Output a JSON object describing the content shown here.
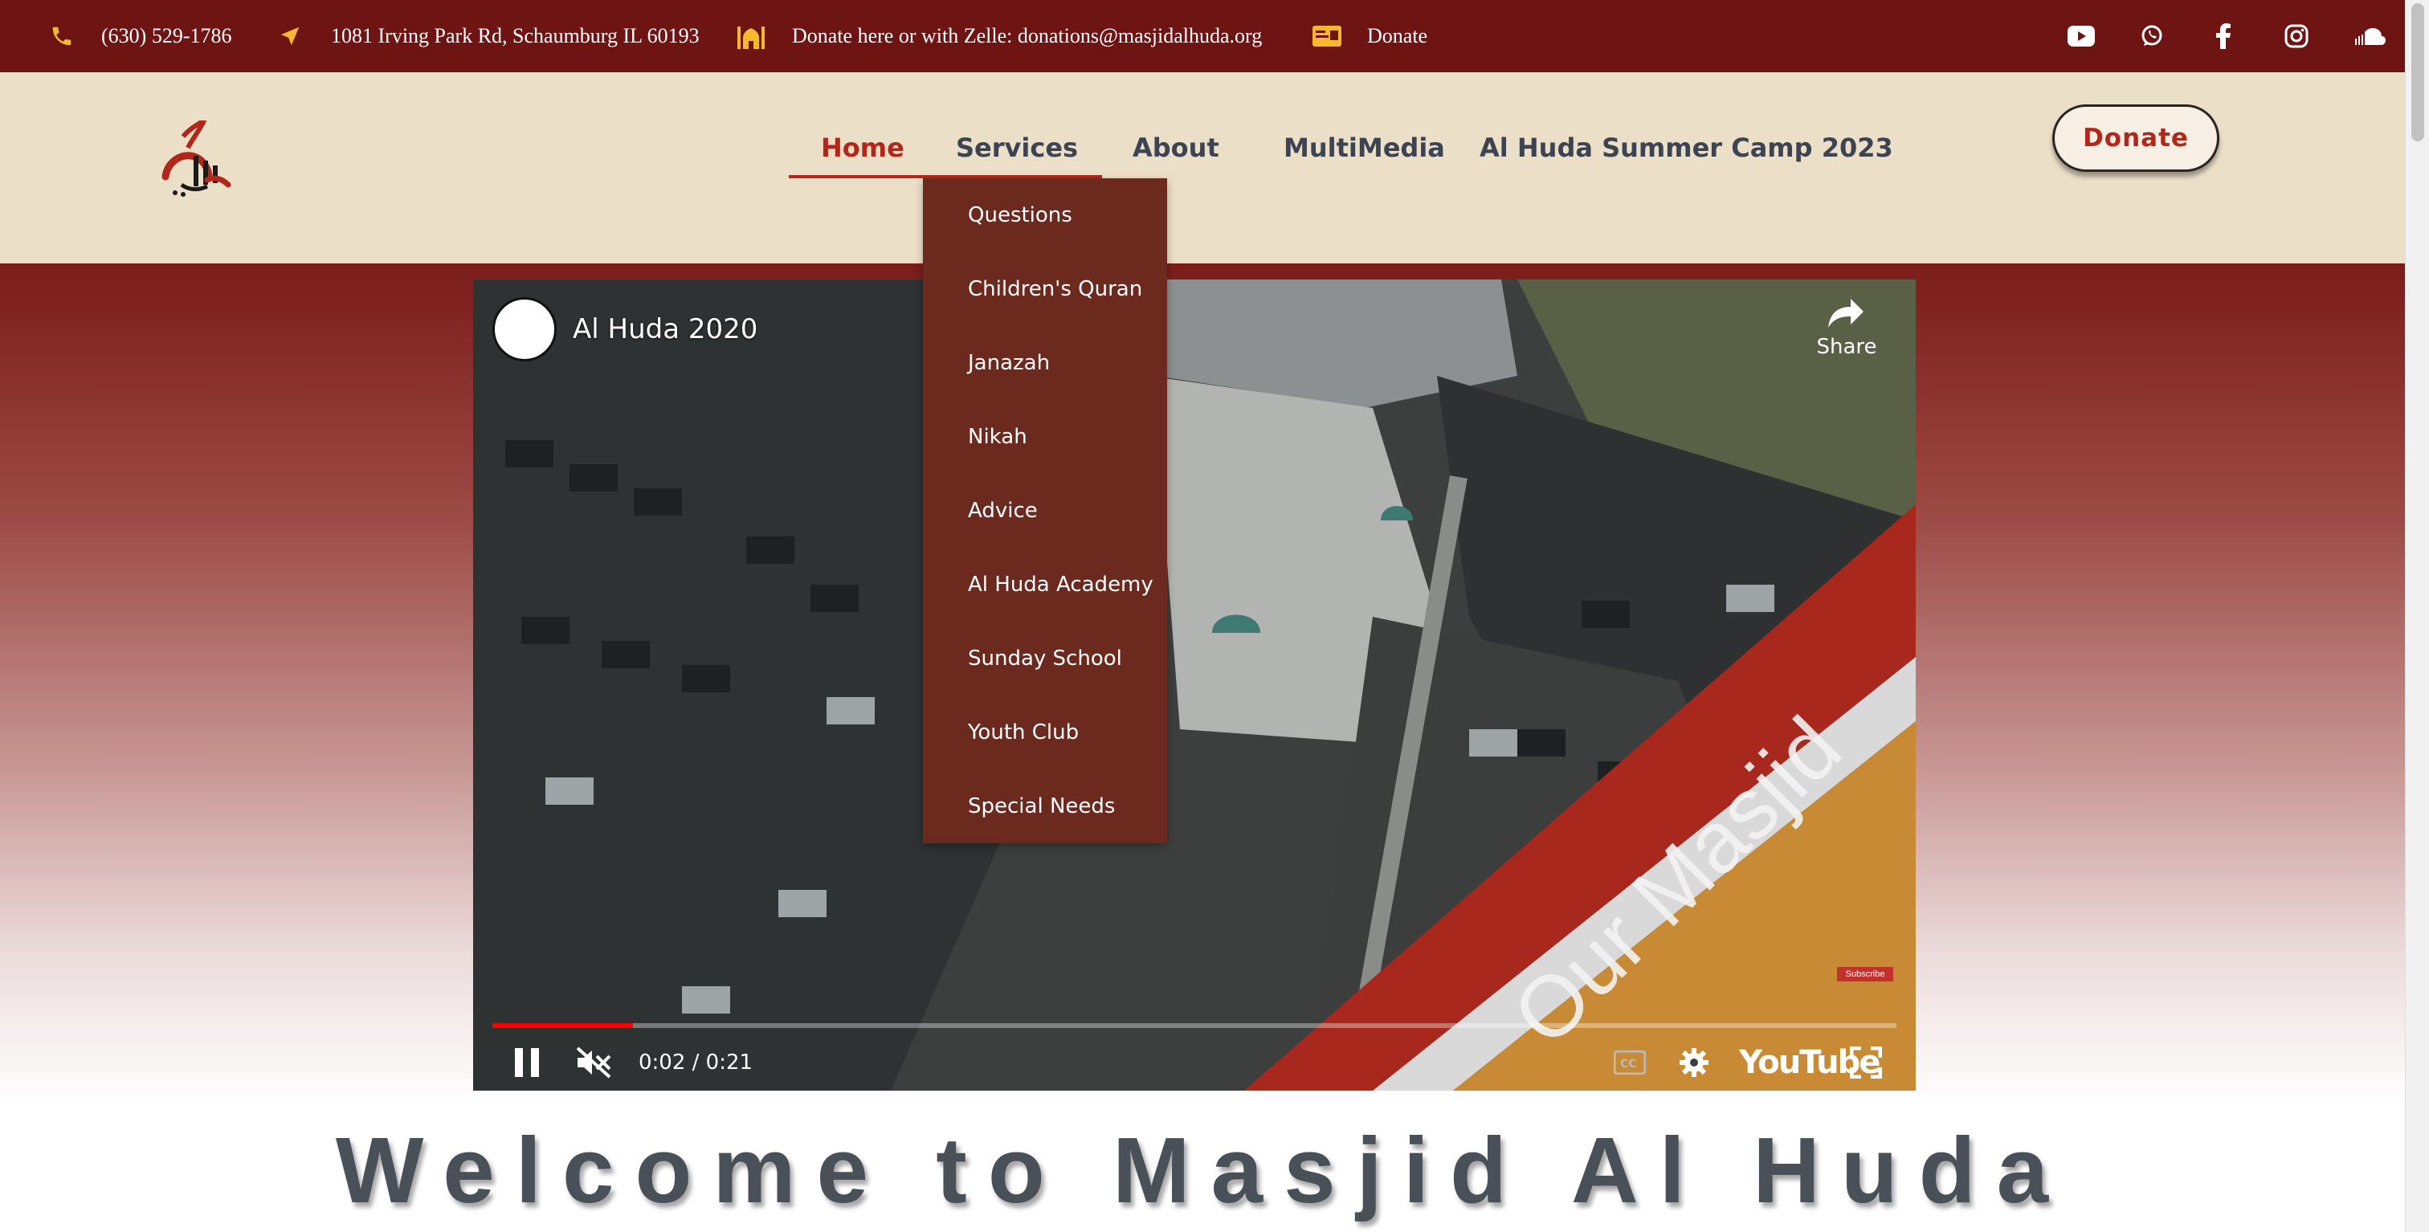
{
  "topbar": {
    "phone": "(630) 529-1786",
    "address": "1081 Irving Park Rd, Schaumburg IL 60193",
    "donate_info": "Donate here or with Zelle: donations@masjidalhuda.org",
    "donate_link": "Donate",
    "icons": [
      "phone-icon",
      "location-arrow-icon",
      "mosque-icon",
      "donation-card-icon"
    ],
    "social": [
      "youtube-icon",
      "whatsapp-icon",
      "facebook-icon",
      "instagram-icon",
      "soundcloud-icon"
    ]
  },
  "header": {
    "nav": [
      "Home",
      "Services",
      "About",
      "MultiMedia",
      "Al Huda Summer Camp 2023"
    ],
    "active": "Home",
    "donate_button": "Donate"
  },
  "dropdown": {
    "items": [
      "Questions",
      "Children's Quran",
      "Janazah",
      "Nikah",
      "Advice",
      "Al Huda Academy",
      "Sunday School",
      "Youth Club",
      "Special Needs"
    ]
  },
  "video": {
    "title": "Al Huda 2020",
    "share_label": "Share",
    "overlay_text": "Our Masjid",
    "time": "0:02 / 0:21",
    "progress": 0.1,
    "youtube_label": "YouTube",
    "subscribe_label": "Subscribe"
  },
  "welcome": {
    "heading": "Welcome to Masjid Al Huda"
  },
  "colors": {
    "topbar_bg": "#6e1413",
    "header_bg": "#ecdfc7",
    "accent": "#b3261c",
    "icon_yellow": "#f5b82e",
    "dropdown_bg": "#6c2a1f"
  }
}
